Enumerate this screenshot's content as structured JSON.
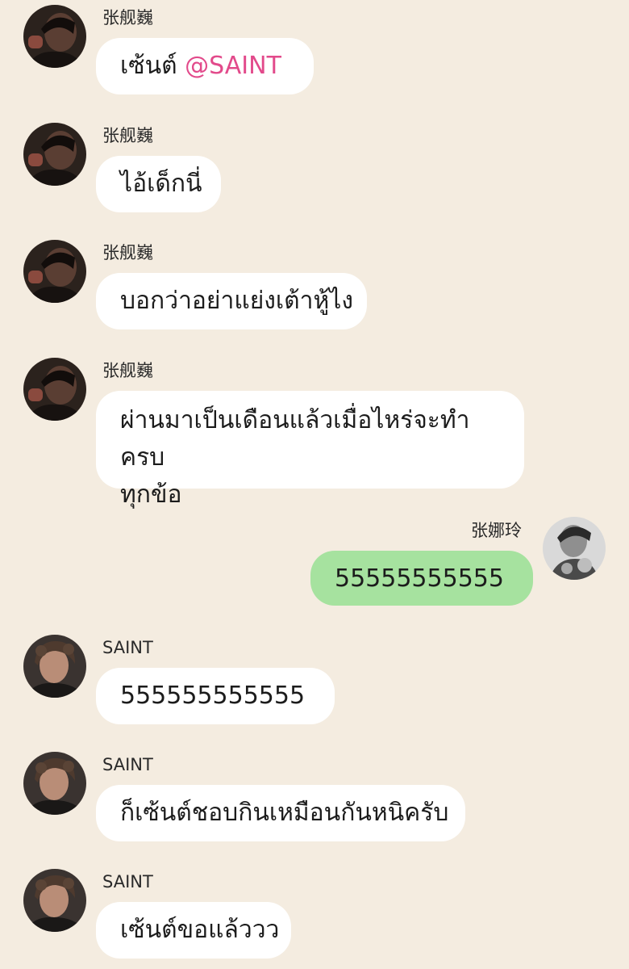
{
  "colors": {
    "background": "#f4ece0",
    "bubble_other": "#ffffff",
    "bubble_self": "#a6e29f",
    "mention": "#e24a8b"
  },
  "messages": [
    {
      "sender": "张舰巍",
      "text": "เซ้นต์ ",
      "mention": "@SAINT",
      "avatar": "dark-portrait-avatar"
    },
    {
      "sender": "张舰巍",
      "text": "ไอ้เด็กนี่",
      "avatar": "dark-portrait-avatar"
    },
    {
      "sender": "张舰巍",
      "text": "บอกว่าอย่าแย่งเต้าหู้ไง",
      "avatar": "dark-portrait-avatar"
    },
    {
      "sender": "张舰巍",
      "line1": "ผ่านมาเป็นเดือนแล้วเมื่อไหร่จะทำครบ",
      "line2": "ทุกข้อ",
      "avatar": "dark-portrait-avatar"
    },
    {
      "sender": "张娜玲",
      "text": "55555555555",
      "avatar": "grayscale-portrait-avatar"
    },
    {
      "sender": "SAINT",
      "text": "555555555555",
      "avatar": "curly-hair-portrait-avatar"
    },
    {
      "sender": "SAINT",
      "text": "ก็เซ้นต์ชอบกินเหมือนกันหนิครับ",
      "avatar": "curly-hair-portrait-avatar"
    },
    {
      "sender": "SAINT",
      "text": "เซ้นต์ขอแล้ววว",
      "avatar": "curly-hair-portrait-avatar"
    }
  ]
}
